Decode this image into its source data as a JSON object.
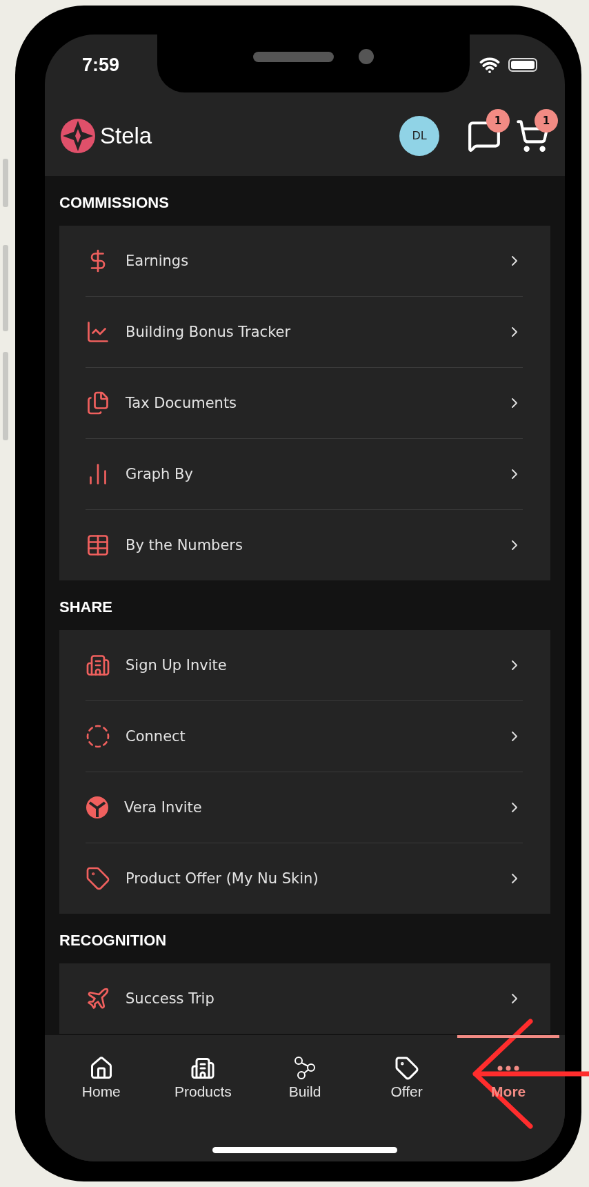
{
  "status_bar": {
    "time": "7:59"
  },
  "header": {
    "app_name": "Stela",
    "avatar": "DL",
    "messages_badge": "1",
    "cart_badge": "1"
  },
  "sections": [
    {
      "title": "COMMISSIONS",
      "items": [
        {
          "label": "Earnings"
        },
        {
          "label": "Building Bonus Tracker"
        },
        {
          "label": "Tax Documents"
        },
        {
          "label": "Graph By"
        },
        {
          "label": "By the Numbers"
        }
      ]
    },
    {
      "title": "SHARE",
      "items": [
        {
          "label": "Sign Up Invite"
        },
        {
          "label": "Connect"
        },
        {
          "label": "Vera Invite"
        },
        {
          "label": "Product Offer (My Nu Skin)"
        }
      ]
    },
    {
      "title": "RECOGNITION",
      "items": [
        {
          "label": "Success Trip"
        }
      ]
    }
  ],
  "tabs": [
    {
      "label": "Home",
      "selected": false
    },
    {
      "label": "Products",
      "selected": false
    },
    {
      "label": "Build",
      "selected": false
    },
    {
      "label": "Offer",
      "selected": false
    },
    {
      "label": "More",
      "selected": true
    }
  ]
}
